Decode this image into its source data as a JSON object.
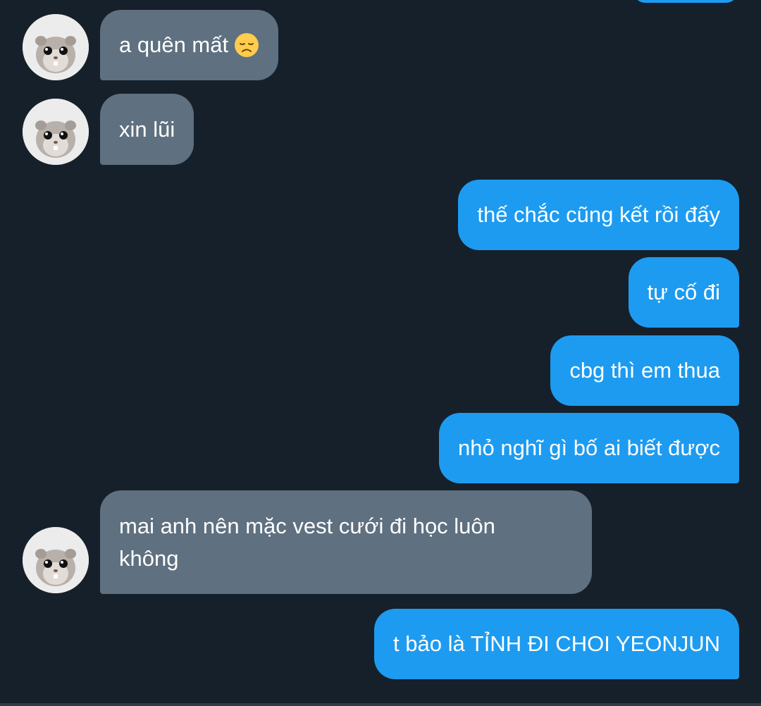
{
  "conversation": {
    "messages": [
      {
        "direction": "incoming",
        "text": "a quên mất",
        "emoji": "disappointed-face"
      },
      {
        "direction": "incoming",
        "text": "xin lũi"
      },
      {
        "direction": "outgoing",
        "text": "thế chắc cũng kết rồi đấy"
      },
      {
        "direction": "outgoing",
        "text": "tự cố đi"
      },
      {
        "direction": "outgoing",
        "text": "cbg thì em thua"
      },
      {
        "direction": "outgoing",
        "text": "nhỏ nghĩ gì bố ai biết được"
      },
      {
        "direction": "incoming",
        "text": "mai anh nên mặc vest cưới đi học luôn không"
      },
      {
        "direction": "outgoing",
        "text": "t bảo là TỈNH ĐI CHOI YEONJUN"
      }
    ]
  },
  "colors": {
    "background": "#16202a",
    "incoming_bubble": "#5f7080",
    "outgoing_bubble": "#1d9bf0",
    "text": "#ffffff"
  },
  "icons": {
    "avatar": "hamster-avatar-icon",
    "emoji": "disappointed-face-emoji-icon"
  }
}
